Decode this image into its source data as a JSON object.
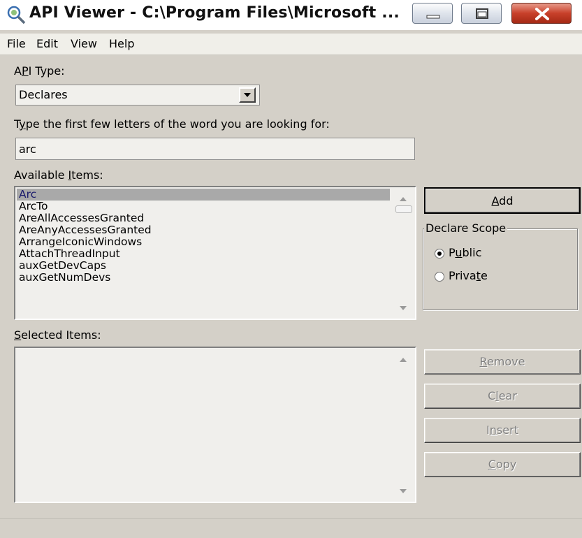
{
  "window": {
    "title": "API Viewer - C:\\Program Files\\Microsoft ...",
    "buttons": [
      "minimize",
      "maximize",
      "close"
    ]
  },
  "menu": [
    "File",
    "Edit",
    "View",
    "Help"
  ],
  "api_type": {
    "label_pre": "A",
    "label_mn": "P",
    "label_post": "I Type:",
    "selected": "Declares"
  },
  "search": {
    "label_mn": "y",
    "label_pre": "T",
    "label_post": "pe the first few letters of the word you are looking for:",
    "value": "arc"
  },
  "available": {
    "label_pre": "Available ",
    "label_mn": "I",
    "label_post": "tems:",
    "items": [
      "Arc",
      "ArcTo",
      "AreAllAccessesGranted",
      "AreAnyAccessesGranted",
      "ArrangeIconicWindows",
      "AttachThreadInput",
      "auxGetDevCaps",
      "auxGetNumDevs"
    ],
    "selected_index": 0
  },
  "selected": {
    "label_mn": "S",
    "label_post": "elected Items:"
  },
  "buttons": {
    "add": {
      "mn": "A",
      "rest": "dd"
    },
    "remove": {
      "mn": "R",
      "rest": "emove"
    },
    "clear": {
      "pre": "C",
      "mn": "l",
      "rest": "ear"
    },
    "insert": {
      "pre": "I",
      "mn": "n",
      "rest": "sert"
    },
    "copy": {
      "mn": "C",
      "rest": "opy"
    }
  },
  "scope": {
    "legend": "Declare Scope",
    "public": {
      "pre": "P",
      "mn": "u",
      "rest": "blic",
      "checked": true
    },
    "private": {
      "pre": "Priva",
      "mn": "t",
      "rest": "e",
      "checked": false
    }
  }
}
